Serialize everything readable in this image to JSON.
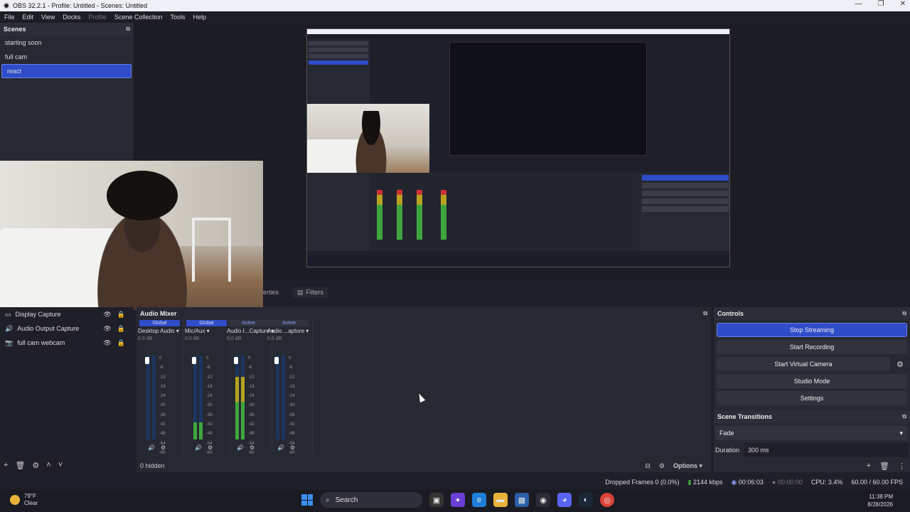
{
  "window": {
    "title": "OBS 32.2.1 - Profile: Untitled - Scenes: Untitled"
  },
  "menu": [
    "File",
    "Edit",
    "View",
    "Docks",
    "Profile",
    "Scene Collection",
    "Tools",
    "Help"
  ],
  "scenes": {
    "title": "Scenes",
    "items": [
      "starting soon",
      "full cam",
      "react"
    ],
    "selected": "react"
  },
  "tabs": {
    "properties_partial": "erties",
    "filters": "Filters"
  },
  "sources": {
    "items": [
      {
        "label": "Display Capture",
        "icon": "monitor-icon"
      },
      {
        "label": "Audio Output Capture",
        "icon": "speaker-icon"
      },
      {
        "label": "full cam webcam",
        "icon": "camera-icon"
      }
    ]
  },
  "mixer": {
    "title": "Audio Mixer",
    "channels": [
      {
        "badge": "Global",
        "name": "Desktop Audio",
        "db": "0.0 dB",
        "level": 0.0
      },
      {
        "badge": "Global",
        "name": "Mic/Aux",
        "db": "0.0 dB",
        "level": 0.2
      },
      {
        "badge": "Active",
        "name": "Audio I...Capture",
        "db": "0.0 dB",
        "level": 0.75
      },
      {
        "badge": "Active",
        "name": "Audio ...apture",
        "db": "0.0 dB",
        "level": 0.0
      }
    ],
    "scale": [
      "0",
      "-6",
      "-12",
      "-18",
      "-24",
      "-30",
      "-36",
      "-42",
      "-48",
      "-54",
      "-60"
    ],
    "hidden": "0 hidden",
    "options": "Options"
  },
  "controls": {
    "title": "Controls",
    "stop_streaming": "Stop Streaming",
    "start_recording": "Start Recording",
    "start_virtual_camera": "Start Virtual Camera",
    "studio_mode": "Studio Mode",
    "settings": "Settings"
  },
  "transitions": {
    "title": "Scene Transitions",
    "selected": "Fade",
    "duration_label": "Duration",
    "duration_value": "300 ms"
  },
  "status": {
    "dropped": "Dropped Frames 0 (0.0%)",
    "kbps": "2144 kbps",
    "stream_time": "00:06:03",
    "rec_time": "00:00:00",
    "cpu": "CPU: 3.4%",
    "fps": "60.00 / 60.00 FPS"
  },
  "taskbar": {
    "temp": "79°F",
    "condition": "Clear",
    "search": "Search",
    "time": "11:38 PM",
    "date": "8/28/2026"
  }
}
